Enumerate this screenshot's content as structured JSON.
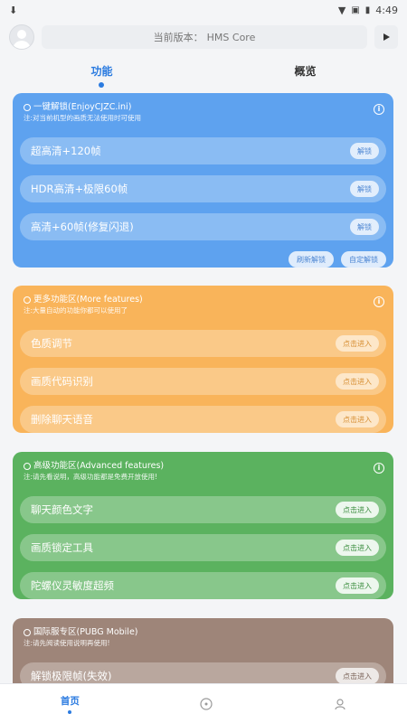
{
  "status": {
    "time": "4:49"
  },
  "header": {
    "version_label": "当前版本：",
    "version_value": "HMS Core"
  },
  "tabs": [
    {
      "label": "功能",
      "active": true
    },
    {
      "label": "概览",
      "active": false
    }
  ],
  "cards": {
    "blue": {
      "title": "一键解锁(EnjoyCJZC.ini)",
      "subtitle": "注:对当前机型的画质无法使用时可使用",
      "rows": [
        {
          "label": "超高清+120帧",
          "button": "解锁"
        },
        {
          "label": "HDR高清+极限60帧",
          "button": "解锁"
        },
        {
          "label": "高清+60帧(修复闪退)",
          "button": "解锁"
        }
      ],
      "actions": [
        "刷新解锁",
        "自定解锁"
      ]
    },
    "orange": {
      "title": "更多功能区(More features)",
      "subtitle": "注:大量自动的功能你都可以使用了",
      "rows": [
        {
          "label": "色质调节",
          "button": "点击进入"
        },
        {
          "label": "画质代码识别",
          "button": "点击进入"
        },
        {
          "label": "删除聊天语音",
          "button": "点击进入"
        }
      ]
    },
    "green": {
      "title": "高级功能区(Advanced features)",
      "subtitle": "注:请先看说明，高级功能都是免费开放使用!",
      "rows": [
        {
          "label": "聊天颜色文字",
          "button": "点击进入"
        },
        {
          "label": "画质锁定工具",
          "button": "点击进入"
        },
        {
          "label": "陀螺仪灵敏度超频",
          "button": "点击进入"
        }
      ]
    },
    "brown": {
      "title": "国际服专区(PUBG Mobile)",
      "subtitle": "注:请先阅读使用说明再使用!",
      "rows": [
        {
          "label": "解锁极限帧(失效)",
          "button": "点击进入"
        }
      ]
    }
  },
  "bottom_nav": [
    {
      "label": "首页",
      "icon": "home",
      "active": true
    },
    {
      "label": "",
      "icon": "compass-icon",
      "active": false
    },
    {
      "label": "",
      "icon": "user-icon",
      "active": false
    }
  ],
  "colors": {
    "accent": "#2b7be0",
    "blue_card": "#5ea2ef",
    "orange_card": "#f9b45a",
    "green_card": "#5bb25f",
    "brown_card": "#9e8579"
  }
}
